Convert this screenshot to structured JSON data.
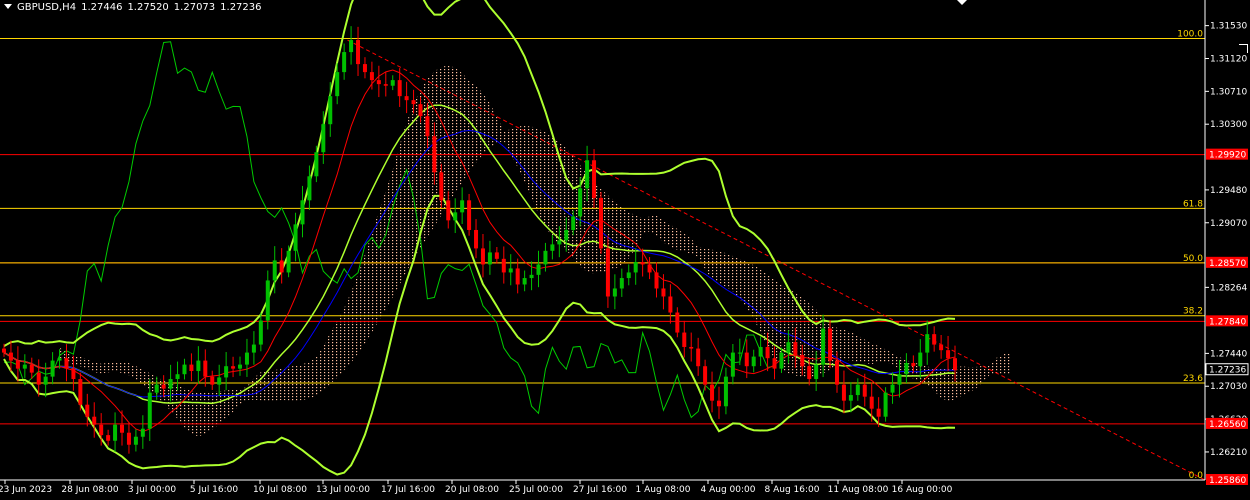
{
  "header": {
    "symbol": "GBPUSD,H4",
    "open": "1.27446",
    "high": "1.27520",
    "low": "1.27073",
    "close": "1.27236"
  },
  "colors": {
    "background": "#000000",
    "bull": "#00c000",
    "bear": "#ff0000",
    "bollinger": "#adff2f",
    "bollinger_inner": "#66ff66",
    "kijun": "#0000ff",
    "tenkan": "#ff0000",
    "chikou": "#00cc00",
    "fibo": "#ffd700",
    "sr_line": "#ff0000",
    "trendline": "#ff0000",
    "cloud": "#ffc0a0"
  },
  "chart_data": {
    "type": "candlestick",
    "y_ticks": [
      "1.31530",
      "1.31120",
      "1.30710",
      "1.30300",
      "1.29480",
      "1.29070",
      "1.28264",
      "1.27440",
      "1.27030",
      "1.26620",
      "1.26210"
    ],
    "ylim": [
      1.2586,
      1.3175
    ],
    "x_ticks": [
      "23 Jun 2023",
      "28 Jun 08:00",
      "3 Jul 00:00",
      "5 Jul 16:00",
      "10 Jul 08:00",
      "13 Jul 00:00",
      "17 Jul 16:00",
      "20 Jul 08:00",
      "25 Jul 00:00",
      "27 Jul 16:00",
      "1 Aug 08:00",
      "4 Aug 00:00",
      "8 Aug 16:00",
      "11 Aug 08:00",
      "16 Aug 00:00"
    ],
    "price_levels": [
      {
        "label": "1.29920",
        "value": 1.2992,
        "boxed": true,
        "color": "#ff0000"
      },
      {
        "label": "1.28570",
        "value": 1.2857,
        "boxed": true,
        "color": "#ff0000"
      },
      {
        "label": "1.27840",
        "value": 1.2784,
        "boxed": true,
        "color": "#ff0000"
      },
      {
        "label": "1.27236",
        "value": 1.27236,
        "boxed": true,
        "color": "#ffffff"
      },
      {
        "label": "1.26560",
        "value": 1.2656,
        "boxed": true,
        "color": "#ff0000"
      },
      {
        "label": "1.25860",
        "value": 1.2586,
        "boxed": true,
        "color": "#ff0000"
      }
    ],
    "fibo_levels": [
      {
        "label": "100.0",
        "value": 1.3137
      },
      {
        "label": "61.8",
        "value": 1.2925
      },
      {
        "label": "50.0",
        "value": 1.2857
      },
      {
        "label": "38.2",
        "value": 1.2791
      },
      {
        "label": "23.6",
        "value": 1.2707
      },
      {
        "label": "0.0",
        "value": 1.2586
      }
    ],
    "close_path": [
      1.2745,
      1.2735,
      1.2725,
      1.273,
      1.272,
      1.2705,
      1.2715,
      1.2735,
      1.2738,
      1.2725,
      1.2712,
      1.268,
      1.2665,
      1.2655,
      1.2642,
      1.2635,
      1.2655,
      1.2645,
      1.263,
      1.264,
      1.265,
      1.2695,
      1.2705,
      1.27,
      1.2712,
      1.2718,
      1.273,
      1.2722,
      1.2735,
      1.2715,
      1.2705,
      1.2714,
      1.2728,
      1.2725,
      1.273,
      1.2745,
      1.2755,
      1.2785,
      1.2835,
      1.286,
      1.2845,
      1.2872,
      1.2905,
      1.2935,
      1.2965,
      1.2995,
      1.303,
      1.3065,
      1.3095,
      1.312,
      1.3135,
      1.3105,
      1.3095,
      1.3085,
      1.308,
      1.3078,
      1.3085,
      1.3065,
      1.306,
      1.3055,
      1.304,
      1.3015,
      1.297,
      1.2935,
      1.291,
      1.292,
      1.2935,
      1.2898,
      1.2875,
      1.2855,
      1.287,
      1.2862,
      1.2845,
      1.285,
      1.283,
      1.2838,
      1.2842,
      1.2855,
      1.2872,
      1.288,
      1.2885,
      1.2898,
      1.2915,
      1.295,
      1.2985,
      1.2938,
      1.2875,
      1.2815,
      1.2825,
      1.2838,
      1.2845,
      1.2858,
      1.2855,
      1.2845,
      1.2825,
      1.2815,
      1.2795,
      1.277,
      1.2752,
      1.275,
      1.2728,
      1.2705,
      1.2685,
      1.2678,
      1.2715,
      1.2745,
      1.2745,
      1.2728,
      1.274,
      1.2752,
      1.2738,
      1.2725,
      1.2745,
      1.2758,
      1.2742,
      1.2728,
      1.2712,
      1.273,
      1.2775,
      1.2735,
      1.2705,
      1.2685,
      1.2692,
      1.2705,
      1.269,
      1.2675,
      1.2665,
      1.2695,
      1.2705,
      1.2718,
      1.2732,
      1.2728,
      1.2745,
      1.2768,
      1.2755,
      1.2748,
      1.2738,
      1.2723
    ],
    "trendline": {
      "from": [
        0.278,
        1.3135
      ],
      "to": [
        0.955,
        1.2598
      ]
    }
  }
}
